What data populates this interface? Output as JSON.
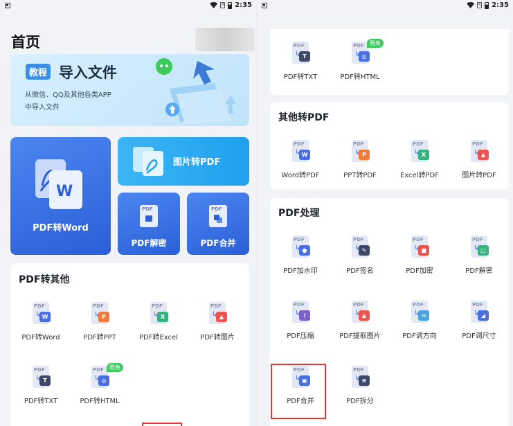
{
  "status": {
    "time": "2:35"
  },
  "left": {
    "page_title": "首页",
    "banner": {
      "tag": "教程",
      "title": "导入文件",
      "desc_line1": "从微信、QQ及其他各类APP",
      "desc_line2": "中导入文件"
    },
    "big_tile": {
      "label": "PDF转Word",
      "icon_letter": "W"
    },
    "image_to_pdf": {
      "label": "图片转PDF"
    },
    "pdf_decrypt": {
      "label": "PDF解密",
      "icon_pdf": "PDF"
    },
    "pdf_merge": {
      "label": "PDF合并",
      "icon_pdf": "PDF"
    },
    "section": {
      "title": "PDF转其他",
      "items": [
        {
          "label": "PDF转Word",
          "color": "#4a6fe0",
          "glyph": "W"
        },
        {
          "label": "PDF转PPT",
          "color": "#f07a3a",
          "glyph": "P"
        },
        {
          "label": "PDF转Excel",
          "color": "#36b37e",
          "glyph": "X"
        },
        {
          "label": "PDF转图片",
          "color": "#ef5350",
          "glyph": "▲"
        },
        {
          "label": "PDF转TXT",
          "color": "#3d4966",
          "glyph": "T"
        },
        {
          "label": "PDF转HTML",
          "color": "#4a6fe0",
          "glyph": "◎",
          "free_badge": "限免"
        }
      ]
    }
  },
  "right": {
    "top_items": [
      {
        "label": "PDF转TXT",
        "color": "#3d4966",
        "glyph": "T"
      },
      {
        "label": "PDF转HTML",
        "color": "#4a6fe0",
        "glyph": "◎",
        "free_badge": "限免"
      }
    ],
    "other_to_pdf": {
      "title": "其他转PDF",
      "items": [
        {
          "label": "Word转PDF",
          "color": "#4a6fe0",
          "glyph": "W"
        },
        {
          "label": "PPT转PDF",
          "color": "#f07a3a",
          "glyph": "P"
        },
        {
          "label": "Excel转PDF",
          "color": "#36b37e",
          "glyph": "X"
        },
        {
          "label": "图片转PDF",
          "color": "#ef5350",
          "glyph": "▲"
        }
      ]
    },
    "pdf_processing": {
      "title": "PDF处理",
      "items": [
        {
          "label": "PDF加水印",
          "color": "#4a6fe0",
          "glyph": "●"
        },
        {
          "label": "PDF签名",
          "color": "#3d4966",
          "glyph": "✎"
        },
        {
          "label": "PDF加密",
          "color": "#ef5350",
          "glyph": "■"
        },
        {
          "label": "PDF解密",
          "color": "#36b37e",
          "glyph": "□"
        },
        {
          "label": "PDF压缩",
          "color": "#7b61c9",
          "glyph": "⋮"
        },
        {
          "label": "PDF提取图片",
          "color": "#ef5350",
          "glyph": "▲"
        },
        {
          "label": "PDF调方向",
          "color": "#4aa3e0",
          "glyph": "⇔"
        },
        {
          "label": "PDF调尺寸",
          "color": "#4a6fe0",
          "glyph": "◢"
        },
        {
          "label": "PDF合并",
          "color": "#4a6fe0",
          "glyph": "▣"
        },
        {
          "label": "PDF拆分",
          "color": "#3d4966",
          "glyph": "≡"
        }
      ]
    }
  }
}
